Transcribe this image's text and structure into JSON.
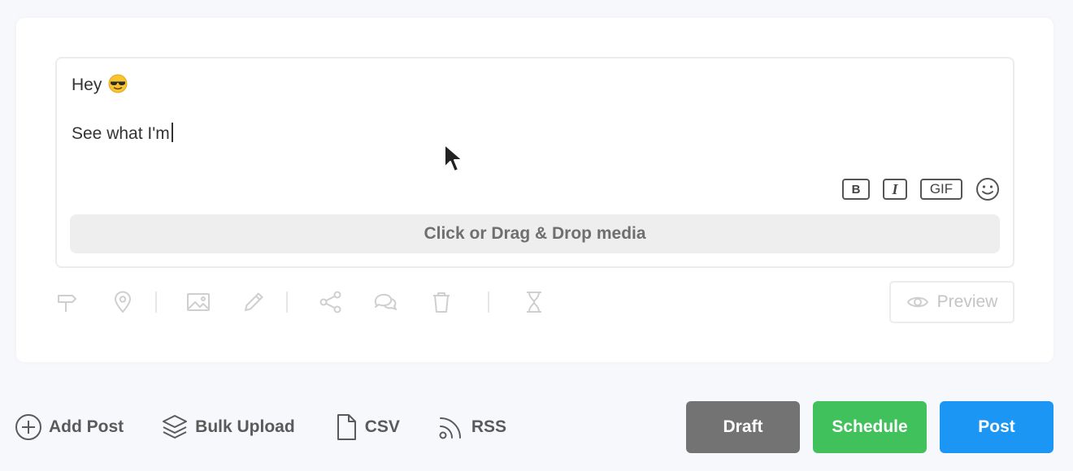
{
  "editor": {
    "line1": "Hey",
    "line1_emoji": "smiling-face-with-sunglasses-emoji",
    "line2": "See what I'm",
    "format_buttons": {
      "bold": "B",
      "italic": "I",
      "gif": "GIF",
      "emoji_icon": "smiley-icon"
    },
    "dropzone_label": "Click or Drag & Drop media"
  },
  "toolbar": {
    "icons": [
      "signpost-icon",
      "location-pin-icon",
      "image-icon",
      "pencil-icon",
      "share-icon",
      "chat-bubbles-icon",
      "trash-icon",
      "hourglass-icon"
    ]
  },
  "preview": {
    "label": "Preview",
    "icon": "eye-icon"
  },
  "bottom": {
    "add_post": "Add Post",
    "bulk_upload": "Bulk Upload",
    "csv": "CSV",
    "rss": "RSS"
  },
  "actions": {
    "draft": "Draft",
    "schedule": "Schedule",
    "post": "Post"
  },
  "colors": {
    "draft": "#737373",
    "schedule": "#41c15b",
    "post": "#1c96f5",
    "disabled_icon": "#cfcfcf"
  }
}
